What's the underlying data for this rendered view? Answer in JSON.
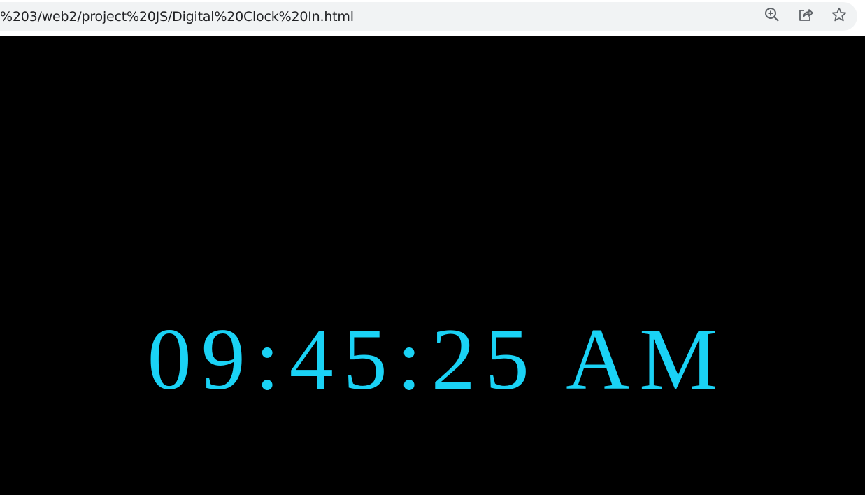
{
  "browser": {
    "url": "%203/web2/project%20JS/Digital%20Clock%20In.html",
    "icons": {
      "zoom": "zoom-in-icon",
      "share": "share-icon",
      "bookmark": "star-icon"
    }
  },
  "page": {
    "background": "#000000",
    "clock": {
      "time": "09:45:25 AM",
      "color": "#1ad2f5"
    }
  }
}
